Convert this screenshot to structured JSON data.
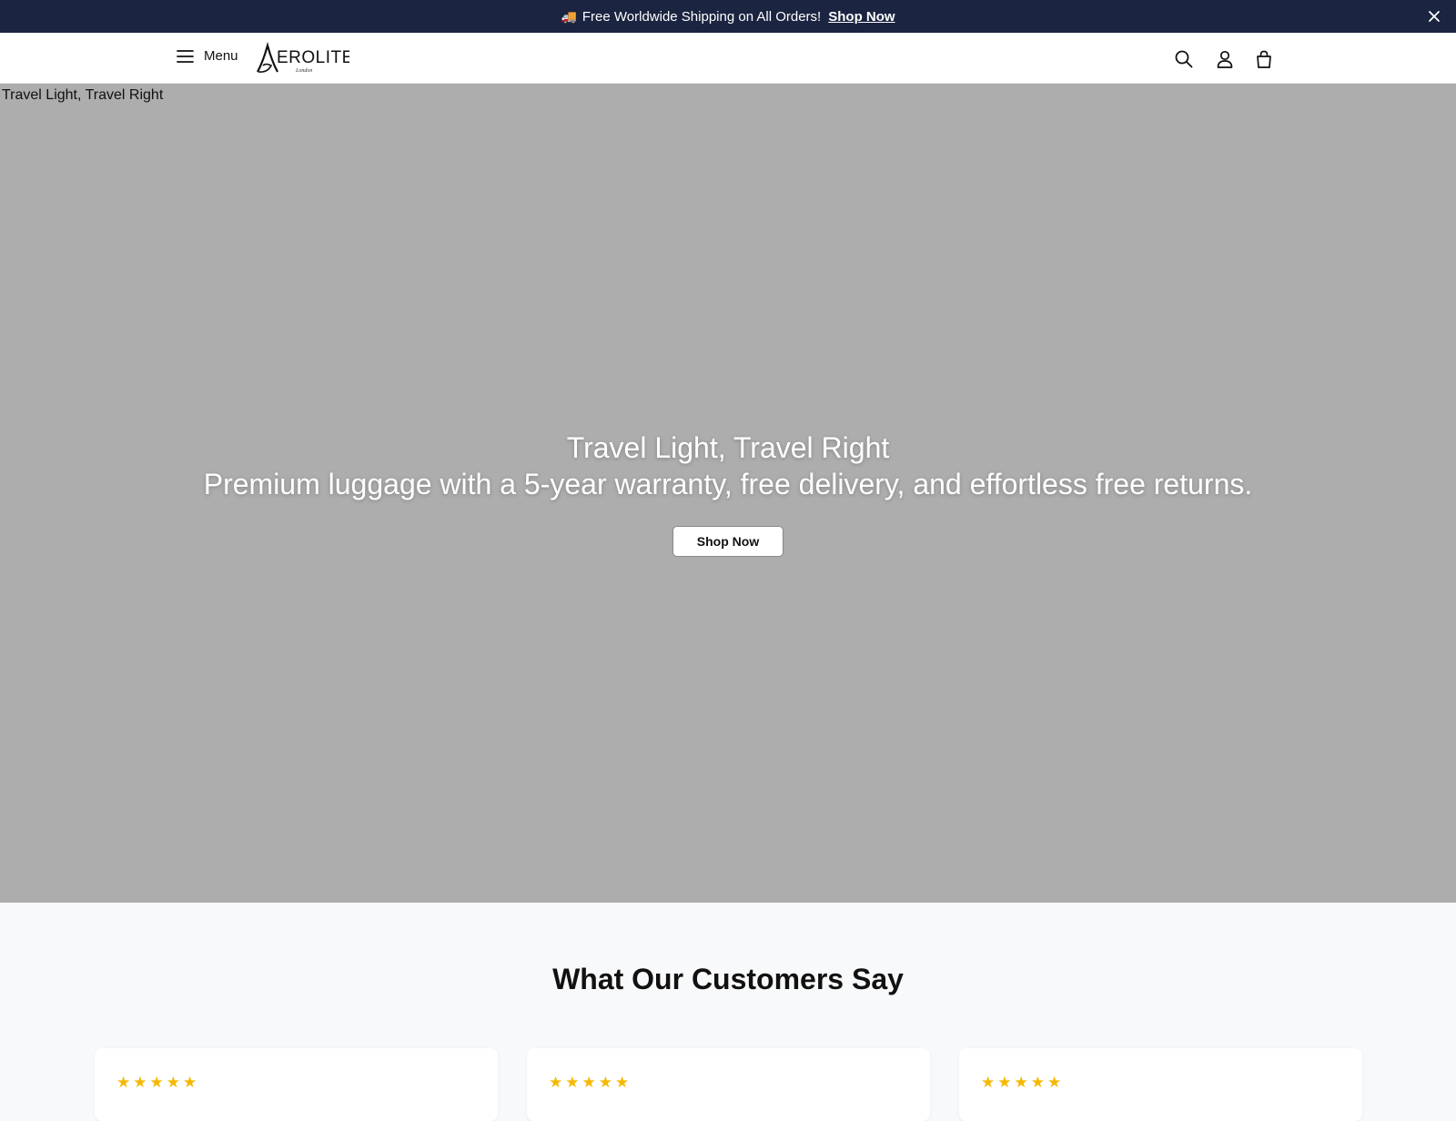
{
  "announcement": {
    "text": "Free Worldwide Shipping on All Orders!",
    "icon": "truck-icon",
    "link_label": "Shop Now"
  },
  "header": {
    "menu_label": "Menu",
    "logo_text": "AEROLITE",
    "logo_subtext": "London",
    "icons": [
      "search-icon",
      "account-icon",
      "cart-icon"
    ]
  },
  "hero": {
    "image_alt": "Travel Light, Travel Right",
    "title": "Travel Light, Travel Right",
    "subtitle": "Premium luggage with a 5-year warranty, free delivery, and effortless free returns.",
    "cta_label": "Shop Now"
  },
  "reviews": {
    "title": "What Our Customers Say",
    "cards": [
      {
        "stars": "★★★★★",
        "rating": 5
      },
      {
        "stars": "★★★★★",
        "rating": 5
      },
      {
        "stars": "★★★★★",
        "rating": 5
      }
    ]
  },
  "colors": {
    "announcement_bg": "#1b2440",
    "hero_bg": "#adadad",
    "star": "#f5b800",
    "page_bg": "#f8f9fa"
  }
}
